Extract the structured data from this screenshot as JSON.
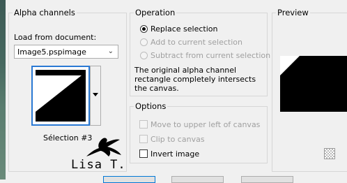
{
  "alpha_channels": {
    "title": "Alpha channels",
    "load_label": "Load from document:",
    "document_value": "Image5.pspimage",
    "selection_name": "Sélection #3"
  },
  "operation": {
    "title": "Operation",
    "options": [
      {
        "label": "Replace selection",
        "selected": true,
        "enabled": true
      },
      {
        "label": "Add to current selection",
        "selected": false,
        "enabled": false
      },
      {
        "label": "Subtract from current selection",
        "selected": false,
        "enabled": false
      }
    ],
    "note": "The original alpha channel rectangle completely intersects the canvas."
  },
  "options": {
    "title": "Options",
    "items": [
      {
        "label": "Move to upper left of canvas",
        "checked": false,
        "enabled": false
      },
      {
        "label": "Clip to canvas",
        "checked": false,
        "enabled": false
      },
      {
        "label": "Invert image",
        "checked": false,
        "enabled": true
      }
    ]
  },
  "preview": {
    "title": "Preview"
  },
  "watermark": {
    "text": "Lisa T."
  },
  "icons": {
    "checker": "transparency-checker-icon",
    "dropdown": "chevron-down-icon"
  }
}
